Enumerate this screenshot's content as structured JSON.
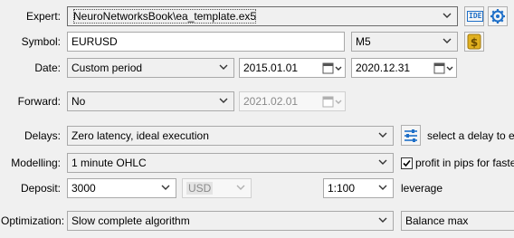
{
  "expert": {
    "label": "Expert:",
    "value": "NeuroNetworksBook\\ea_template.ex5",
    "ide_label": "IDE"
  },
  "symbol": {
    "label": "Symbol:",
    "value": "EURUSD",
    "timeframe": "M5"
  },
  "date": {
    "label": "Date:",
    "period": "Custom period",
    "from": "2015.01.01",
    "to": "2020.12.31"
  },
  "forward": {
    "label": "Forward:",
    "value": "No",
    "date": "2021.02.01"
  },
  "delays": {
    "label": "Delays:",
    "value": "Zero latency, ideal execution",
    "hint": "select a delay to em"
  },
  "modelling": {
    "label": "Modelling:",
    "value": "1 minute OHLC",
    "checkbox_label": "profit in pips for faster c",
    "checked": true
  },
  "deposit": {
    "label": "Deposit:",
    "amount": "3000",
    "currency": "USD",
    "leverage": "1:100",
    "leverage_label": "leverage"
  },
  "optimization": {
    "label": "Optimization:",
    "value": "Slow complete algorithm",
    "criterion": "Balance max"
  },
  "icons": {
    "settings": "gear-icon",
    "symbol": "dollar-icon",
    "calendar": "calendar-icon",
    "delays": "sliders-icon",
    "dropdown": "chevron-down-icon"
  },
  "colors": {
    "accent_blue": "#1e6fc8",
    "symbol_gold": "#e0b020",
    "window_bg": "#f0f0f0"
  }
}
